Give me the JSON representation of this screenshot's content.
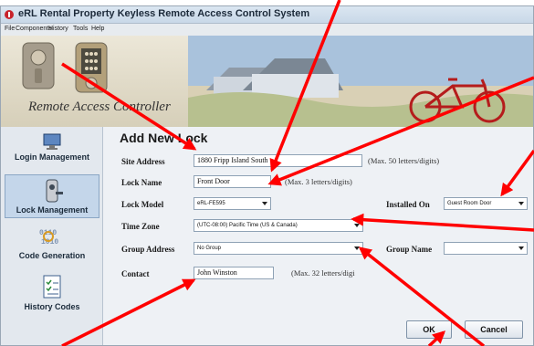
{
  "window": {
    "title": "eRL Rental Property Keyless Remote Access Control System"
  },
  "menu": [
    "File",
    "Components",
    "History",
    "Tools",
    "Help"
  ],
  "banner": {
    "logo_text": "Remote Access Controller"
  },
  "sidebar": {
    "items": [
      {
        "label": "Login Management",
        "icon": "login-icon",
        "active": false
      },
      {
        "label": "Lock Management",
        "icon": "lock-icon",
        "active": true
      },
      {
        "label": "Code Generation",
        "icon": "code-icon",
        "active": false
      },
      {
        "label": "History Codes",
        "icon": "history-icon",
        "active": false
      }
    ]
  },
  "form": {
    "title": "Add New Lock",
    "site_address": {
      "label": "Site Address",
      "value": "1880 Fripp Island South",
      "hint": "(Max. 50 letters/digits)"
    },
    "lock_name": {
      "label": "Lock Name",
      "value": "Front Door",
      "hint": "(Max. 3 letters/digits)"
    },
    "lock_model": {
      "label": "Lock Model",
      "value": "eRL-FE595"
    },
    "installed_on": {
      "label": "Installed On",
      "value": "Guest Room Door"
    },
    "time_zone": {
      "label": "Time Zone",
      "value": "(UTC-08:00) Pacific Time (US & Canada)"
    },
    "group_address": {
      "label": "Group Address",
      "value": "No Group"
    },
    "group_name": {
      "label": "Group Name",
      "value": ""
    },
    "contact": {
      "label": "Contact",
      "value": "John Winston",
      "hint": "(Max. 32 letters/digi"
    },
    "ok_label": "OK",
    "cancel_label": "Cancel"
  },
  "annotation_color": "#ff0000"
}
